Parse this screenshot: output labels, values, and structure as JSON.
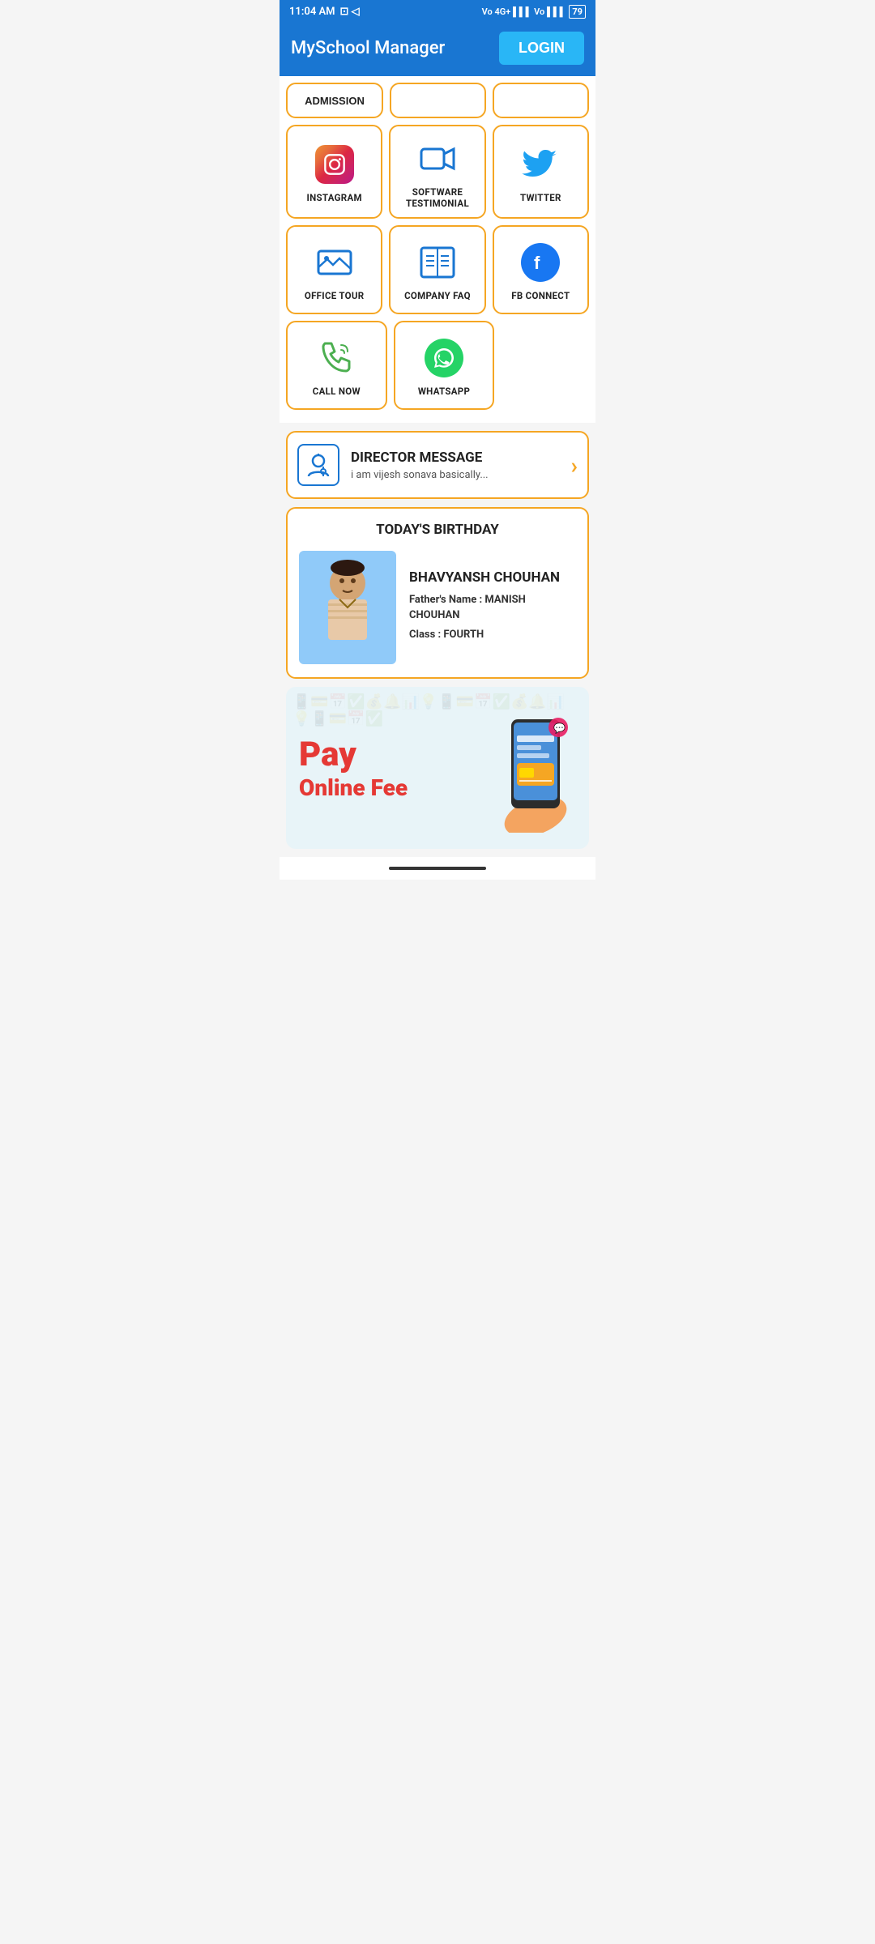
{
  "statusBar": {
    "time": "11:04 AM",
    "icons": "d",
    "battery": "79"
  },
  "header": {
    "title": "MySchool Manager",
    "loginLabel": "LOGIN"
  },
  "admission": {
    "label": "ADMISSION"
  },
  "gridItems": [
    {
      "id": "instagram",
      "label": "INSTAGRAM",
      "icon": "instagram"
    },
    {
      "id": "software-testimonial",
      "label": "SOFTWARE TESTIMONIAL",
      "icon": "video"
    },
    {
      "id": "twitter",
      "label": "TWITTER",
      "icon": "twitter"
    },
    {
      "id": "office-tour",
      "label": "OFFICE TOUR",
      "icon": "image"
    },
    {
      "id": "company-faq",
      "label": "COMPANY FAQ",
      "icon": "faq"
    },
    {
      "id": "fb-connect",
      "label": "FB CONNECT",
      "icon": "facebook"
    },
    {
      "id": "call-now",
      "label": "CALL NOW",
      "icon": "phone"
    },
    {
      "id": "whatsapp",
      "label": "WHATSAPP",
      "icon": "whatsapp"
    }
  ],
  "directorMessage": {
    "title": "DIRECTOR MESSAGE",
    "subtitle": "i am vijesh sonava basically..."
  },
  "birthday": {
    "sectionTitle": "TODAY'S BIRTHDAY",
    "name": "BHAVYANSH CHOUHAN",
    "fatherLabel": "Father's Name :",
    "fatherName": "MANISH CHOUHAN",
    "classLabel": "Class :",
    "className": "FOURTH"
  },
  "payBanner": {
    "line1": "Pay",
    "line2": "Online Fee"
  }
}
